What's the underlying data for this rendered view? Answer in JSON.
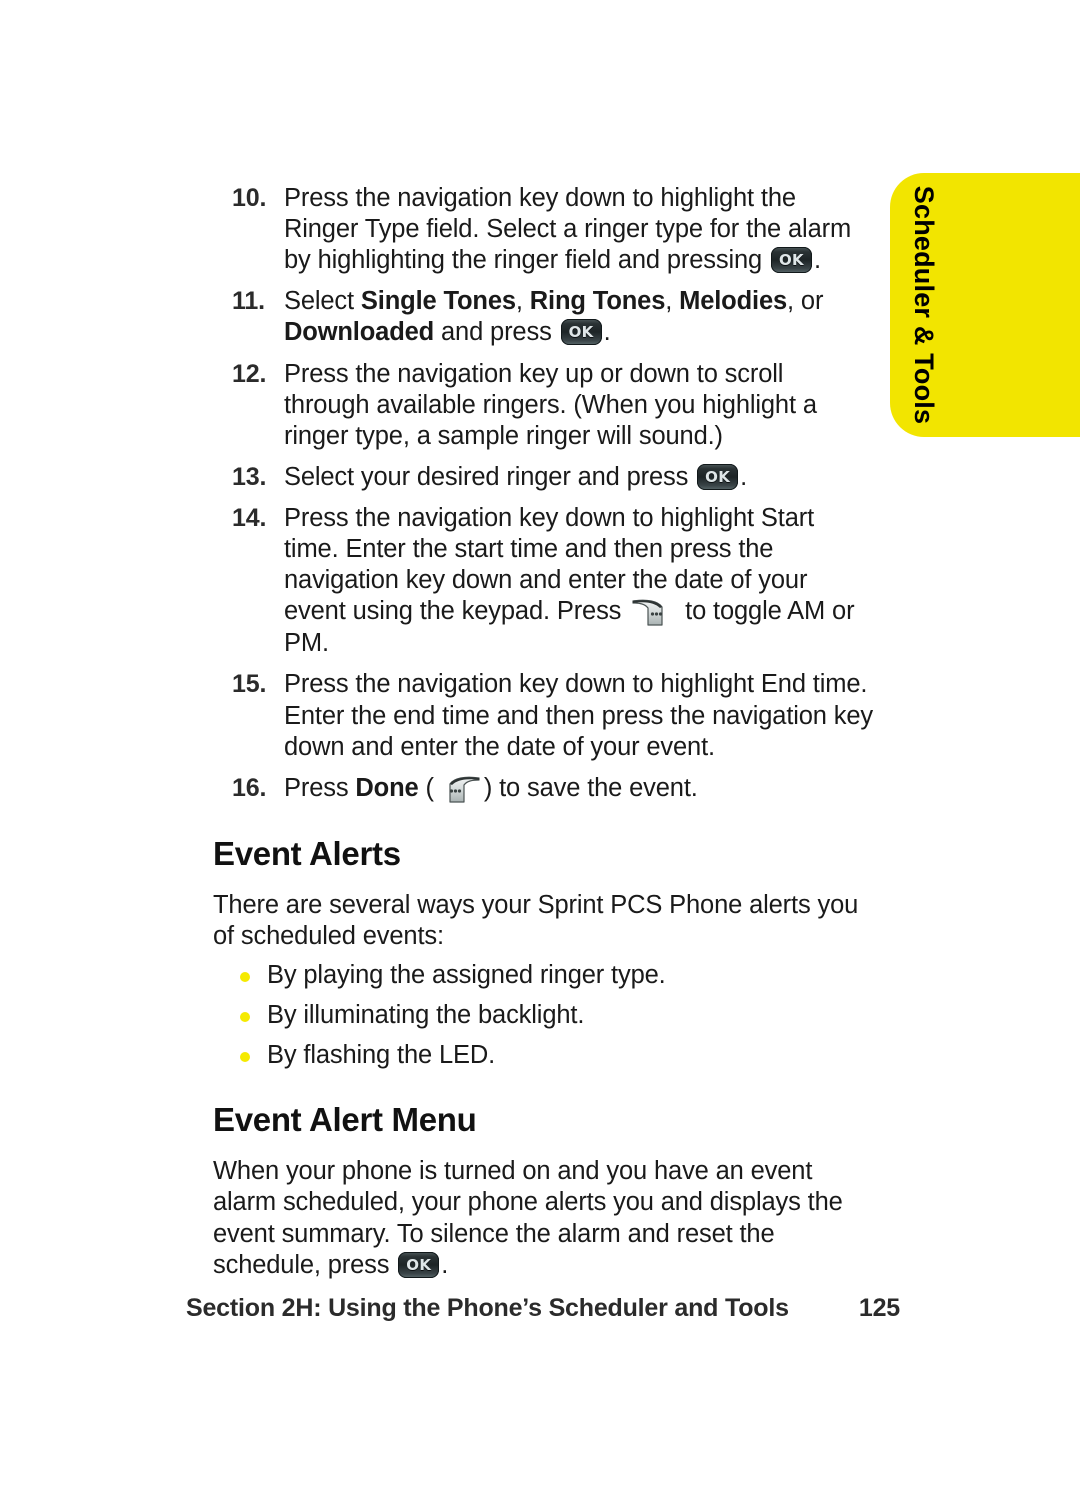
{
  "side_tab": {
    "label": "Scheduler & Tools",
    "background_color": "#f2e500",
    "text_color": "#000000"
  },
  "icons": {
    "ok_key": "ok-key-icon",
    "ok_key_label": "OK",
    "soft_key_right": "right-soft-key-icon",
    "soft_key_left": "left-soft-key-icon"
  },
  "steps": [
    {
      "number": "10.",
      "parts": [
        {
          "type": "text",
          "value": "Press the navigation key down to highlight the Ringer Type field. Select a ringer type for the alarm by highlighting the ringer field and pressing "
        },
        {
          "type": "icon",
          "value": "ok-key-icon"
        },
        {
          "type": "text",
          "value": "."
        }
      ]
    },
    {
      "number": "11.",
      "parts": [
        {
          "type": "text",
          "value": "Select "
        },
        {
          "type": "bold",
          "value": "Single Tones"
        },
        {
          "type": "text",
          "value": ", "
        },
        {
          "type": "bold",
          "value": "Ring Tones"
        },
        {
          "type": "text",
          "value": ", "
        },
        {
          "type": "bold",
          "value": "Melodies"
        },
        {
          "type": "text",
          "value": ", or "
        },
        {
          "type": "bold",
          "value": "Downloaded"
        },
        {
          "type": "text",
          "value": " and press "
        },
        {
          "type": "icon",
          "value": "ok-key-icon"
        },
        {
          "type": "text",
          "value": "."
        }
      ]
    },
    {
      "number": "12.",
      "parts": [
        {
          "type": "text",
          "value": "Press the navigation key up or down to scroll through available ringers. (When you highlight a ringer type, a sample ringer will sound.)"
        }
      ]
    },
    {
      "number": "13.",
      "parts": [
        {
          "type": "text",
          "value": "Select your desired ringer and press "
        },
        {
          "type": "icon",
          "value": "ok-key-icon"
        },
        {
          "type": "text",
          "value": "."
        }
      ]
    },
    {
      "number": "14.",
      "parts": [
        {
          "type": "text",
          "value": "Press the navigation key down to highlight Start time. Enter the start time and then press the navigation key down and enter the date of your event using the keypad. Press "
        },
        {
          "type": "icon",
          "value": "right-soft-key-icon"
        },
        {
          "type": "text",
          "value": " to toggle AM or PM."
        }
      ]
    },
    {
      "number": "15.",
      "parts": [
        {
          "type": "text",
          "value": "Press the navigation key down to highlight End time. Enter the end time and then press the navigation key down and enter the date of your event."
        }
      ]
    },
    {
      "number": "16.",
      "parts": [
        {
          "type": "text",
          "value": "Press "
        },
        {
          "type": "bold",
          "value": "Done"
        },
        {
          "type": "text",
          "value": " ("
        },
        {
          "type": "icon",
          "value": "left-soft-key-icon"
        },
        {
          "type": "text",
          "value": ") to save the event."
        }
      ]
    }
  ],
  "event_alerts": {
    "heading": "Event Alerts",
    "intro": "There are several ways your Sprint PCS Phone alerts you of scheduled events:",
    "bullets": [
      "By playing the assigned ringer type.",
      "By illuminating the backlight.",
      "By flashing the LED."
    ],
    "bullet_color": "#f5ea00"
  },
  "event_alert_menu": {
    "heading": "Event Alert Menu",
    "paragraph_parts": [
      {
        "type": "text",
        "value": "When your phone is turned on and you have an event alarm scheduled, your phone alerts you and displays the event summary. To silence the alarm and reset the schedule, press "
      },
      {
        "type": "icon",
        "value": "ok-key-icon"
      },
      {
        "type": "text",
        "value": "."
      }
    ]
  },
  "footer": {
    "section": "Section 2H: Using the Phone’s Scheduler and Tools",
    "page_number": "125"
  }
}
